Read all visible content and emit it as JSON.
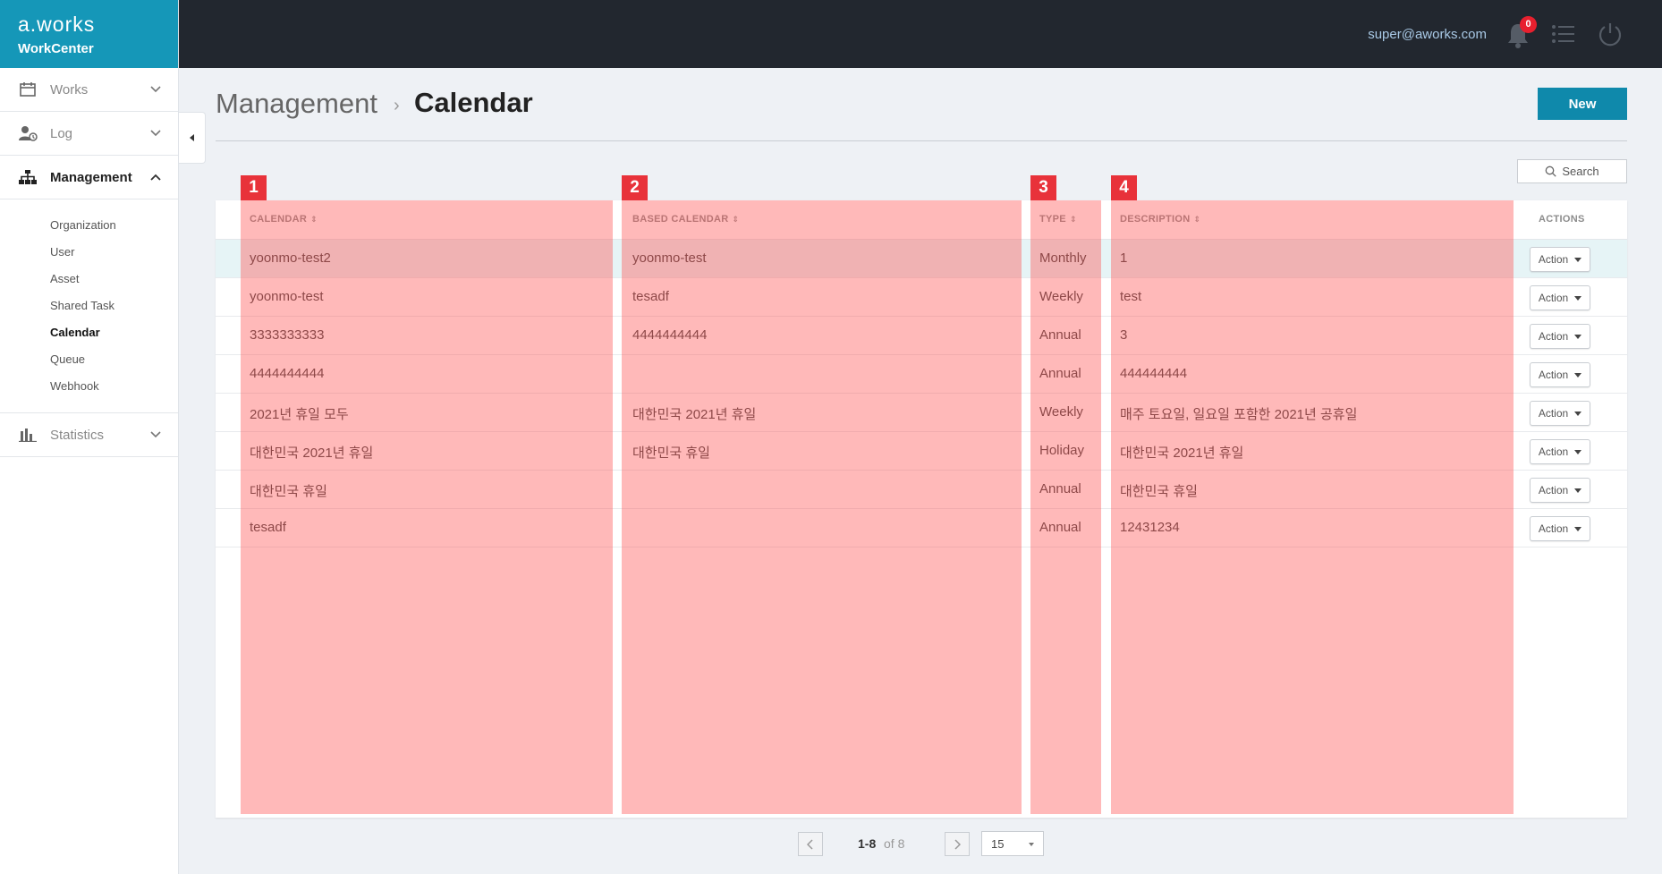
{
  "brand": {
    "logo": "a.works",
    "product": "WorkCenter"
  },
  "topbar": {
    "user_email": "super@aworks.com",
    "notification_count": "0"
  },
  "sidebar": {
    "items": [
      {
        "label": "Works",
        "icon": "calendar-icon"
      },
      {
        "label": "Log",
        "icon": "user-log-icon"
      },
      {
        "label": "Management",
        "icon": "org-chart-icon"
      },
      {
        "label": "Statistics",
        "icon": "bar-chart-icon"
      }
    ],
    "management_sub": [
      "Organization",
      "User",
      "Asset",
      "Shared Task",
      "Calendar",
      "Queue",
      "Webhook"
    ]
  },
  "header": {
    "parent": "Management",
    "separator": "›",
    "current": "Calendar",
    "new_label": "New"
  },
  "search": {
    "label": "Search"
  },
  "table": {
    "columns": [
      "CALENDAR",
      "BASED CALENDAR",
      "TYPE",
      "DESCRIPTION",
      "ACTIONS"
    ],
    "action_label": "Action",
    "rows": [
      {
        "calendar": "yoonmo-test2",
        "based": "yoonmo-test",
        "type": "Monthly",
        "description": "1"
      },
      {
        "calendar": "yoonmo-test",
        "based": "tesadf",
        "type": "Weekly",
        "description": "test"
      },
      {
        "calendar": "3333333333",
        "based": "4444444444",
        "type": "Annual",
        "description": "3"
      },
      {
        "calendar": "4444444444",
        "based": "",
        "type": "Annual",
        "description": "444444444"
      },
      {
        "calendar": "2021년 휴일 모두",
        "based": "대한민국 2021년 휴일",
        "type": "Weekly",
        "description": "매주 토요일, 일요일 포함한 2021년 공휴일"
      },
      {
        "calendar": "대한민국 2021년 휴일",
        "based": "대한민국 휴일",
        "type": "Holiday",
        "description": "대한민국 2021년 휴일"
      },
      {
        "calendar": "대한민국 휴일",
        "based": "",
        "type": "Annual",
        "description": "대한민국 휴일"
      },
      {
        "calendar": "tesadf",
        "based": "",
        "type": "Annual",
        "description": "12431234"
      }
    ]
  },
  "highlights": [
    "1",
    "2",
    "3",
    "4"
  ],
  "pagination": {
    "range": "1-8",
    "of_total": "of 8",
    "page_size": "15"
  },
  "colors": {
    "brand": "#1597b8",
    "topbar": "#22272f",
    "primary_button": "#0f89ab",
    "highlight": "#ff5050",
    "badge": "#e8202e"
  }
}
